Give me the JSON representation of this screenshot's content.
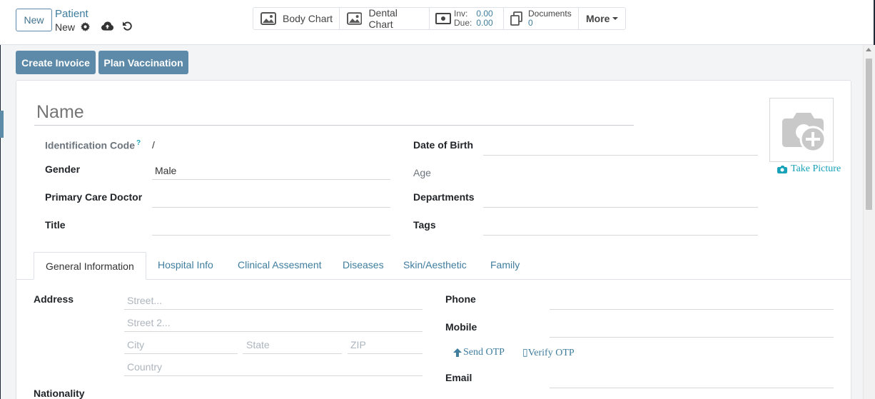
{
  "control_panel": {
    "new_button": "New",
    "breadcrumb_parent": "Patient",
    "breadcrumb_current": "New"
  },
  "smart_buttons": {
    "body_chart": "Body Chart",
    "dental_chart": "Dental Chart",
    "inv_label": "Inv:",
    "inv_value": "0.00",
    "due_label": "Due:",
    "due_value": "0.00",
    "documents_label": "Documents",
    "documents_count": "0",
    "more": "More"
  },
  "actions": {
    "create_invoice": "Create Invoice",
    "plan_vaccination": "Plan Vaccination"
  },
  "form": {
    "name_placeholder": "Name",
    "identification_code_label": "Identification Code",
    "help_mark": "?",
    "identification_code_value": "/",
    "gender_label": "Gender",
    "gender_value": "Male",
    "primary_care_doctor_label": "Primary Care Doctor",
    "title_label": "Title",
    "date_of_birth_label": "Date of Birth",
    "age_label": "Age",
    "departments_label": "Departments",
    "tags_label": "Tags",
    "take_picture": "Take Picture"
  },
  "tabs": [
    {
      "label": "General Information",
      "active": true
    },
    {
      "label": "Hospital Info",
      "active": false
    },
    {
      "label": "Clinical Assesment",
      "active": false
    },
    {
      "label": "Diseases",
      "active": false
    },
    {
      "label": "Skin/Aesthetic",
      "active": false
    },
    {
      "label": "Family",
      "active": false
    }
  ],
  "general_info": {
    "address_label": "Address",
    "street_placeholder": "Street...",
    "street2_placeholder": "Street 2...",
    "city_placeholder": "City",
    "state_placeholder": "State",
    "zip_placeholder": "ZIP",
    "country_placeholder": "Country",
    "nationality_label": "Nationality",
    "phone_label": "Phone",
    "mobile_label": "Mobile",
    "send_otp": "Send OTP",
    "verify_otp": "Verify OTP",
    "verify_otp_glyph": "▯",
    "email_label": "Email"
  },
  "colors": {
    "primary": "#5d8aa8",
    "link": "#3f7d9e",
    "info": "#17a2b8"
  }
}
